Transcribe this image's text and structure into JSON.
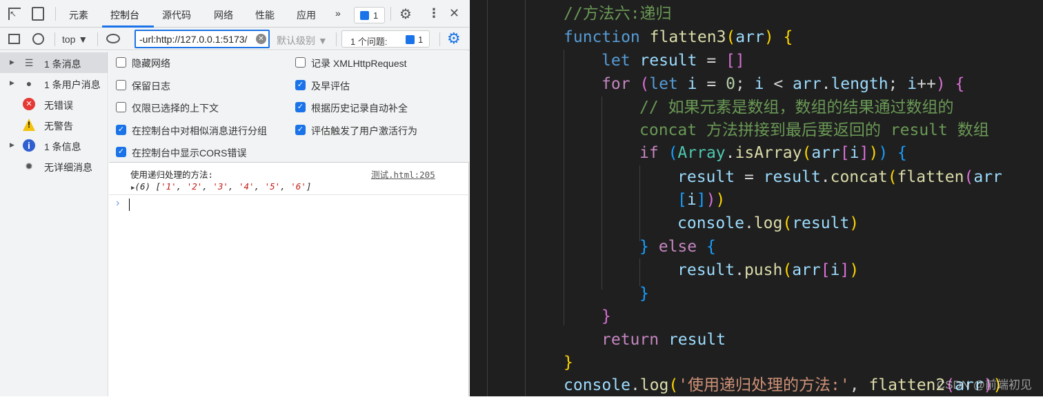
{
  "devtools": {
    "tabs": [
      "元素",
      "控制台",
      "源代码",
      "网络",
      "性能",
      "应用"
    ],
    "active_tab": "控制台",
    "more": "»",
    "messages_badge": "1",
    "context": "top ▼",
    "filter_value": "-url:http://127.0.0.1:5173/",
    "levels": "默认级别 ▼",
    "issues_label": "1 个问题:",
    "issues_count": "1",
    "accent": "#1a73e8",
    "sidebar": [
      {
        "label": "1 条消息",
        "icon": "list-icon",
        "expand": true,
        "selected": true
      },
      {
        "label": "1 条用户消息",
        "icon": "user-icon",
        "expand": true
      },
      {
        "label": "无错误",
        "icon": "error-icon",
        "expand": false
      },
      {
        "label": "无警告",
        "icon": "warning-icon",
        "expand": false
      },
      {
        "label": "1 条信息",
        "icon": "info-icon",
        "expand": true
      },
      {
        "label": "无详细消息",
        "icon": "bug-icon",
        "expand": false
      }
    ],
    "settings": [
      {
        "label": "隐藏网络",
        "checked": false
      },
      {
        "label": "记录 XMLHttpRequest",
        "checked": false
      },
      {
        "label": "保留日志",
        "checked": false
      },
      {
        "label": "及早评估",
        "checked": true
      },
      {
        "label": "仅限已选择的上下文",
        "checked": false
      },
      {
        "label": "根据历史记录自动补全",
        "checked": true
      },
      {
        "label": "在控制台中对相似消息进行分组",
        "checked": true
      },
      {
        "label": "评估触发了用户激活行为",
        "checked": true
      },
      {
        "label": "在控制台中显示CORS错误",
        "checked": true
      }
    ],
    "log": {
      "message": "使用递归处理的方法:",
      "source": "测试.html:205",
      "array_prefix": "(6) ",
      "array_values": [
        "'1'",
        "'2'",
        "'3'",
        "'4'",
        "'5'",
        "'6'"
      ]
    },
    "prompt": "›"
  },
  "editor": {
    "watermark": "CSDN @前端初见",
    "lines": [
      {
        "indent": 0,
        "tokens": [
          [
            "//方法六:递归",
            "cm"
          ]
        ]
      },
      {
        "indent": 0,
        "tokens": [
          [
            "function",
            "kw"
          ],
          [
            " ",
            "pl"
          ],
          [
            "flatten3",
            "fn"
          ],
          [
            "(",
            "b1"
          ],
          [
            "arr",
            "var"
          ],
          [
            ")",
            "b1"
          ],
          [
            " ",
            "pl"
          ],
          [
            "{",
            "b1"
          ]
        ]
      },
      {
        "indent": 1,
        "tokens": [
          [
            "let",
            "kw"
          ],
          [
            " ",
            "pl"
          ],
          [
            "result",
            "var"
          ],
          [
            " = ",
            "pl"
          ],
          [
            "[]",
            "b2"
          ]
        ]
      },
      {
        "indent": 1,
        "tokens": [
          [
            "for",
            "ctl"
          ],
          [
            " ",
            "pl"
          ],
          [
            "(",
            "b2"
          ],
          [
            "let",
            "kw"
          ],
          [
            " ",
            "pl"
          ],
          [
            "i",
            "var"
          ],
          [
            " = ",
            "pl"
          ],
          [
            "0",
            "num"
          ],
          [
            "; ",
            "pl"
          ],
          [
            "i",
            "var"
          ],
          [
            " < ",
            "pl"
          ],
          [
            "arr",
            "var"
          ],
          [
            ".",
            "pl"
          ],
          [
            "length",
            "var"
          ],
          [
            "; ",
            "pl"
          ],
          [
            "i",
            "var"
          ],
          [
            "++",
            "pl"
          ],
          [
            ")",
            "b2"
          ],
          [
            " ",
            "pl"
          ],
          [
            "{",
            "b2"
          ]
        ]
      },
      {
        "indent": 2,
        "tokens": [
          [
            "// 如果元素是数组，数组的结果通过数组的",
            "cm"
          ]
        ]
      },
      {
        "indent": 2,
        "tokens": [
          [
            "concat 方法拼接到最后要返回的 result 数组",
            "cm"
          ]
        ]
      },
      {
        "indent": 2,
        "tokens": [
          [
            "if",
            "ctl"
          ],
          [
            " ",
            "pl"
          ],
          [
            "(",
            "b3"
          ],
          [
            "Array",
            "cls"
          ],
          [
            ".",
            "pl"
          ],
          [
            "isArray",
            "fn"
          ],
          [
            "(",
            "b1"
          ],
          [
            "arr",
            "var"
          ],
          [
            "[",
            "b2"
          ],
          [
            "i",
            "var"
          ],
          [
            "]",
            "b2"
          ],
          [
            ")",
            "b1"
          ],
          [
            ")",
            "b3"
          ],
          [
            " ",
            "pl"
          ],
          [
            "{",
            "b3"
          ]
        ]
      },
      {
        "indent": 3,
        "tokens": [
          [
            "result",
            "var"
          ],
          [
            " = ",
            "pl"
          ],
          [
            "result",
            "var"
          ],
          [
            ".",
            "pl"
          ],
          [
            "concat",
            "fn"
          ],
          [
            "(",
            "b1"
          ],
          [
            "flatten",
            "fn"
          ],
          [
            "(",
            "b2"
          ],
          [
            "arr",
            "var"
          ]
        ]
      },
      {
        "indent": 3,
        "tokens": [
          [
            "[",
            "b3"
          ],
          [
            "i",
            "var"
          ],
          [
            "]",
            "b3"
          ],
          [
            ")",
            "b2"
          ],
          [
            ")",
            "b1"
          ]
        ]
      },
      {
        "indent": 3,
        "tokens": [
          [
            "console",
            "var"
          ],
          [
            ".",
            "pl"
          ],
          [
            "log",
            "fn"
          ],
          [
            "(",
            "b1"
          ],
          [
            "result",
            "var"
          ],
          [
            ")",
            "b1"
          ]
        ]
      },
      {
        "indent": 2,
        "tokens": [
          [
            "}",
            "b3"
          ],
          [
            " ",
            "pl"
          ],
          [
            "else",
            "ctl"
          ],
          [
            " ",
            "pl"
          ],
          [
            "{",
            "b3"
          ]
        ]
      },
      {
        "indent": 3,
        "tokens": [
          [
            "result",
            "var"
          ],
          [
            ".",
            "pl"
          ],
          [
            "push",
            "fn"
          ],
          [
            "(",
            "b1"
          ],
          [
            "arr",
            "var"
          ],
          [
            "[",
            "b2"
          ],
          [
            "i",
            "var"
          ],
          [
            "]",
            "b2"
          ],
          [
            ")",
            "b1"
          ]
        ]
      },
      {
        "indent": 2,
        "tokens": [
          [
            "}",
            "b3"
          ]
        ]
      },
      {
        "indent": 1,
        "tokens": [
          [
            "}",
            "b2"
          ]
        ]
      },
      {
        "indent": 1,
        "tokens": [
          [
            "return",
            "ctl"
          ],
          [
            " ",
            "pl"
          ],
          [
            "result",
            "var"
          ]
        ]
      },
      {
        "indent": 0,
        "tokens": [
          [
            "}",
            "b1"
          ]
        ]
      },
      {
        "indent": 0,
        "tokens": [
          [
            "console",
            "var"
          ],
          [
            ".",
            "pl"
          ],
          [
            "log",
            "fn"
          ],
          [
            "(",
            "b1"
          ],
          [
            "'使用递归处理的方法:'",
            "str"
          ],
          [
            ", ",
            "pl"
          ],
          [
            "flatten2",
            "fn"
          ],
          [
            "(",
            "b2"
          ],
          [
            "arr",
            "var"
          ],
          [
            ")",
            "b2"
          ],
          [
            ")",
            "b1"
          ]
        ]
      }
    ]
  }
}
